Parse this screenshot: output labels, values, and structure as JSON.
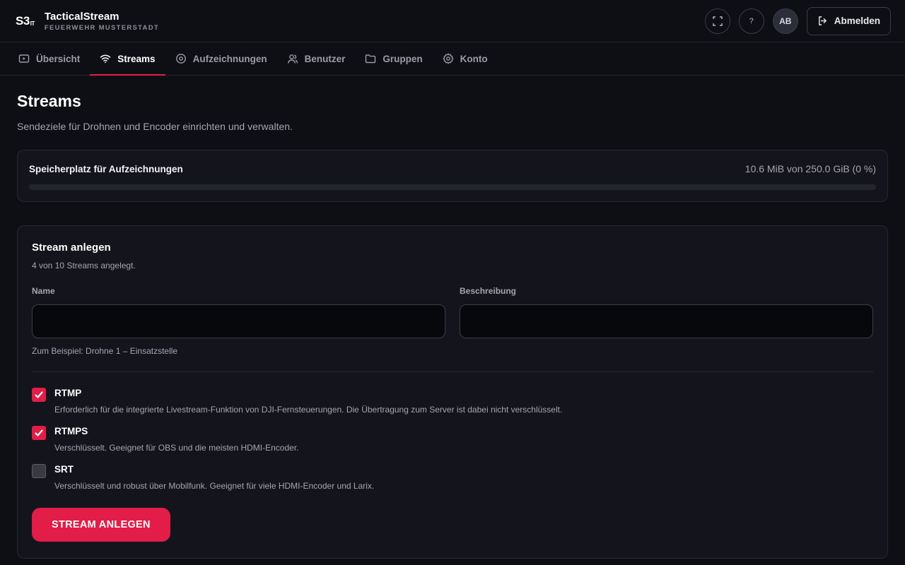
{
  "brand": {
    "logo": "S3",
    "logo_sub": "IT",
    "title": "TacticalStream",
    "subtitle": "FEUERWEHR MUSTERSTADT"
  },
  "header": {
    "help_label": "?",
    "avatar_initials": "AB",
    "logout_label": "Abmelden"
  },
  "nav": {
    "items": [
      {
        "label": "Übersicht",
        "icon": "play-icon",
        "active": false
      },
      {
        "label": "Streams",
        "icon": "wifi-icon",
        "active": true
      },
      {
        "label": "Aufzeichnungen",
        "icon": "record-icon",
        "active": false
      },
      {
        "label": "Benutzer",
        "icon": "user-icon",
        "active": false
      },
      {
        "label": "Gruppen",
        "icon": "folder-icon",
        "active": false
      },
      {
        "label": "Konto",
        "icon": "gear-icon",
        "active": false
      }
    ]
  },
  "page": {
    "title": "Streams",
    "subtitle": "Sendeziele für Drohnen und Encoder einrichten und verwalten."
  },
  "storage": {
    "label": "Speicherplatz für Aufzeichnungen",
    "value": "10.6 MiB von 250.0 GiB (0 %)",
    "fill_percent": 0
  },
  "form": {
    "title": "Stream anlegen",
    "subtitle": "4 von 10 Streams angelegt.",
    "name_label": "Name",
    "name_value": "",
    "description_label": "Beschreibung",
    "description_value": "",
    "name_hint": "Zum Beispiel: Drohne 1 – Einsatzstelle",
    "protocols": [
      {
        "name": "RTMP",
        "checked": true,
        "description": "Erforderlich für die integrierte Livestream-Funktion von DJI-Fernsteuerungen. Die Übertragung zum Server ist dabei nicht verschlüsselt."
      },
      {
        "name": "RTMPS",
        "checked": true,
        "description": "Verschlüsselt. Geeignet für OBS und die meisten HDMI-Encoder."
      },
      {
        "name": "SRT",
        "checked": false,
        "description": "Verschlüsselt und robust über Mobilfunk. Geeignet für viele HDMI-Encoder und Larix."
      }
    ],
    "submit_label": "STREAM ANLEGEN"
  },
  "colors": {
    "accent": "#e11d48",
    "background": "#0e0f14",
    "card": "#14151c"
  }
}
